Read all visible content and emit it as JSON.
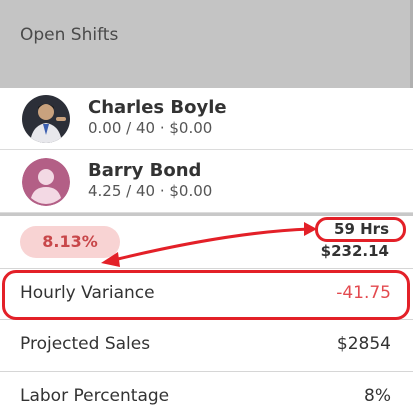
{
  "header": {
    "title": "Open Shifts"
  },
  "employees": [
    {
      "name": "Charles Boyle",
      "summary": "0.00 / 40 · $0.00"
    },
    {
      "name": "Barry Bond",
      "summary": "4.25 / 40 · $0.00"
    }
  ],
  "totals": {
    "percent_badge": "8.13%",
    "hours": "59 Hrs",
    "cost": "$232.14"
  },
  "stats": [
    {
      "label": "Hourly Variance",
      "value": "-41.75"
    },
    {
      "label": "Projected Sales",
      "value": "$2854"
    },
    {
      "label": "Labor Percentage",
      "value": "8%"
    }
  ],
  "colors": {
    "header_bg": "#c4c4c4",
    "annotation_red": "#e32028",
    "negative_value": "#e34a4f",
    "badge_bg": "#f8d3d3",
    "badge_text": "#c8474a",
    "default_avatar": "#b35f86"
  },
  "icons": {
    "charles_avatar": "person-photo",
    "barry_avatar": "user-silhouette-icon"
  }
}
